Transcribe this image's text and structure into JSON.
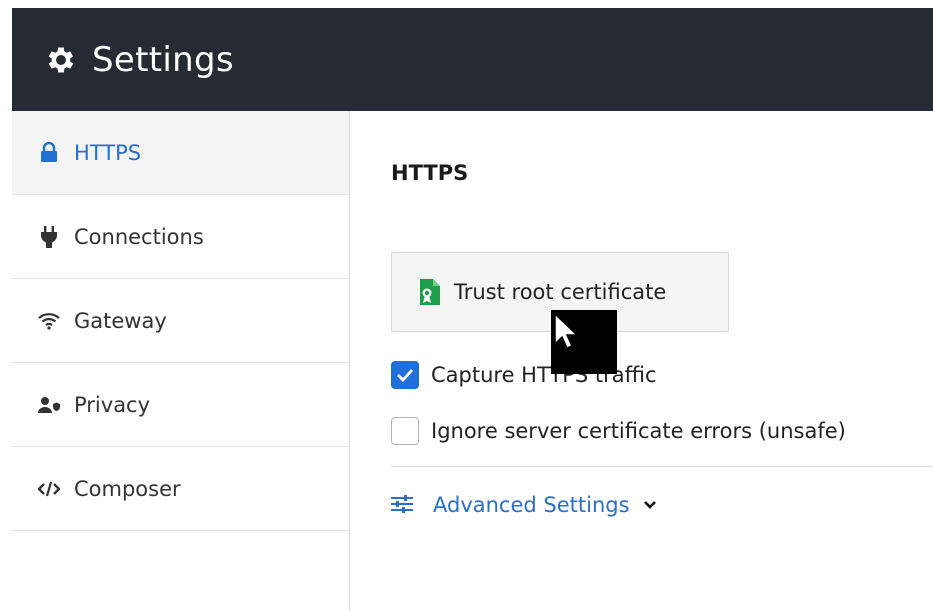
{
  "header": {
    "title": "Settings",
    "icon": "gear-icon"
  },
  "sidebar": {
    "items": [
      {
        "label": "HTTPS",
        "icon": "lock-icon",
        "active": true
      },
      {
        "label": "Connections",
        "icon": "plug-icon",
        "active": false
      },
      {
        "label": "Gateway",
        "icon": "wifi-icon",
        "active": false
      },
      {
        "label": "Privacy",
        "icon": "user-shield-icon",
        "active": false
      },
      {
        "label": "Composer",
        "icon": "code-icon",
        "active": false
      }
    ]
  },
  "main": {
    "section_title": "HTTPS",
    "trust_button_label": "Trust root certificate",
    "capture_https": {
      "label": "Capture HTTPS traffic",
      "checked": true
    },
    "ignore_errors": {
      "label": "Ignore server certificate errors (unsafe)",
      "checked": false
    },
    "advanced_label": "Advanced Settings"
  },
  "colors": {
    "header_bg": "#252a33",
    "accent": "#1f6fd6",
    "link": "#2a6fc9",
    "cert_green": "#1e9e4a"
  }
}
